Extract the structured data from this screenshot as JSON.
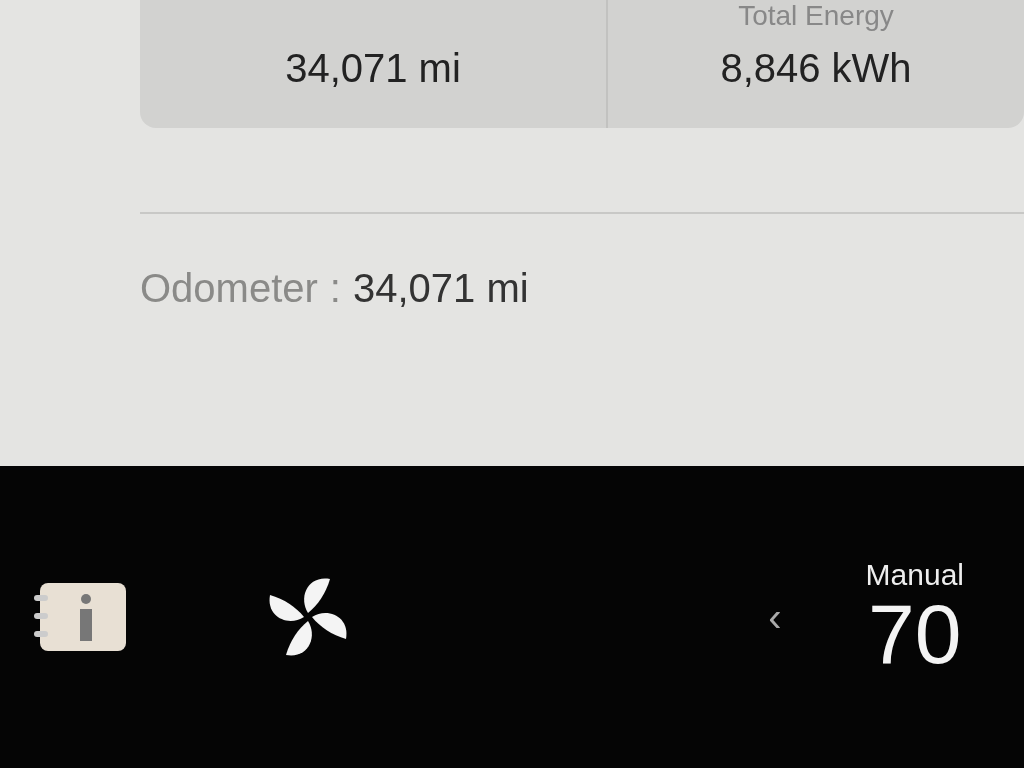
{
  "stats": [
    {
      "value": "34,071 mi"
    },
    {
      "label": "Total Energy",
      "value": "8,846 kWh"
    }
  ],
  "odometer": {
    "label": "Odometer",
    "separator": ":",
    "value": "34,071 mi"
  },
  "bottom_bar": {
    "chevron": "‹",
    "mode": "Manual",
    "temperature": "70"
  }
}
